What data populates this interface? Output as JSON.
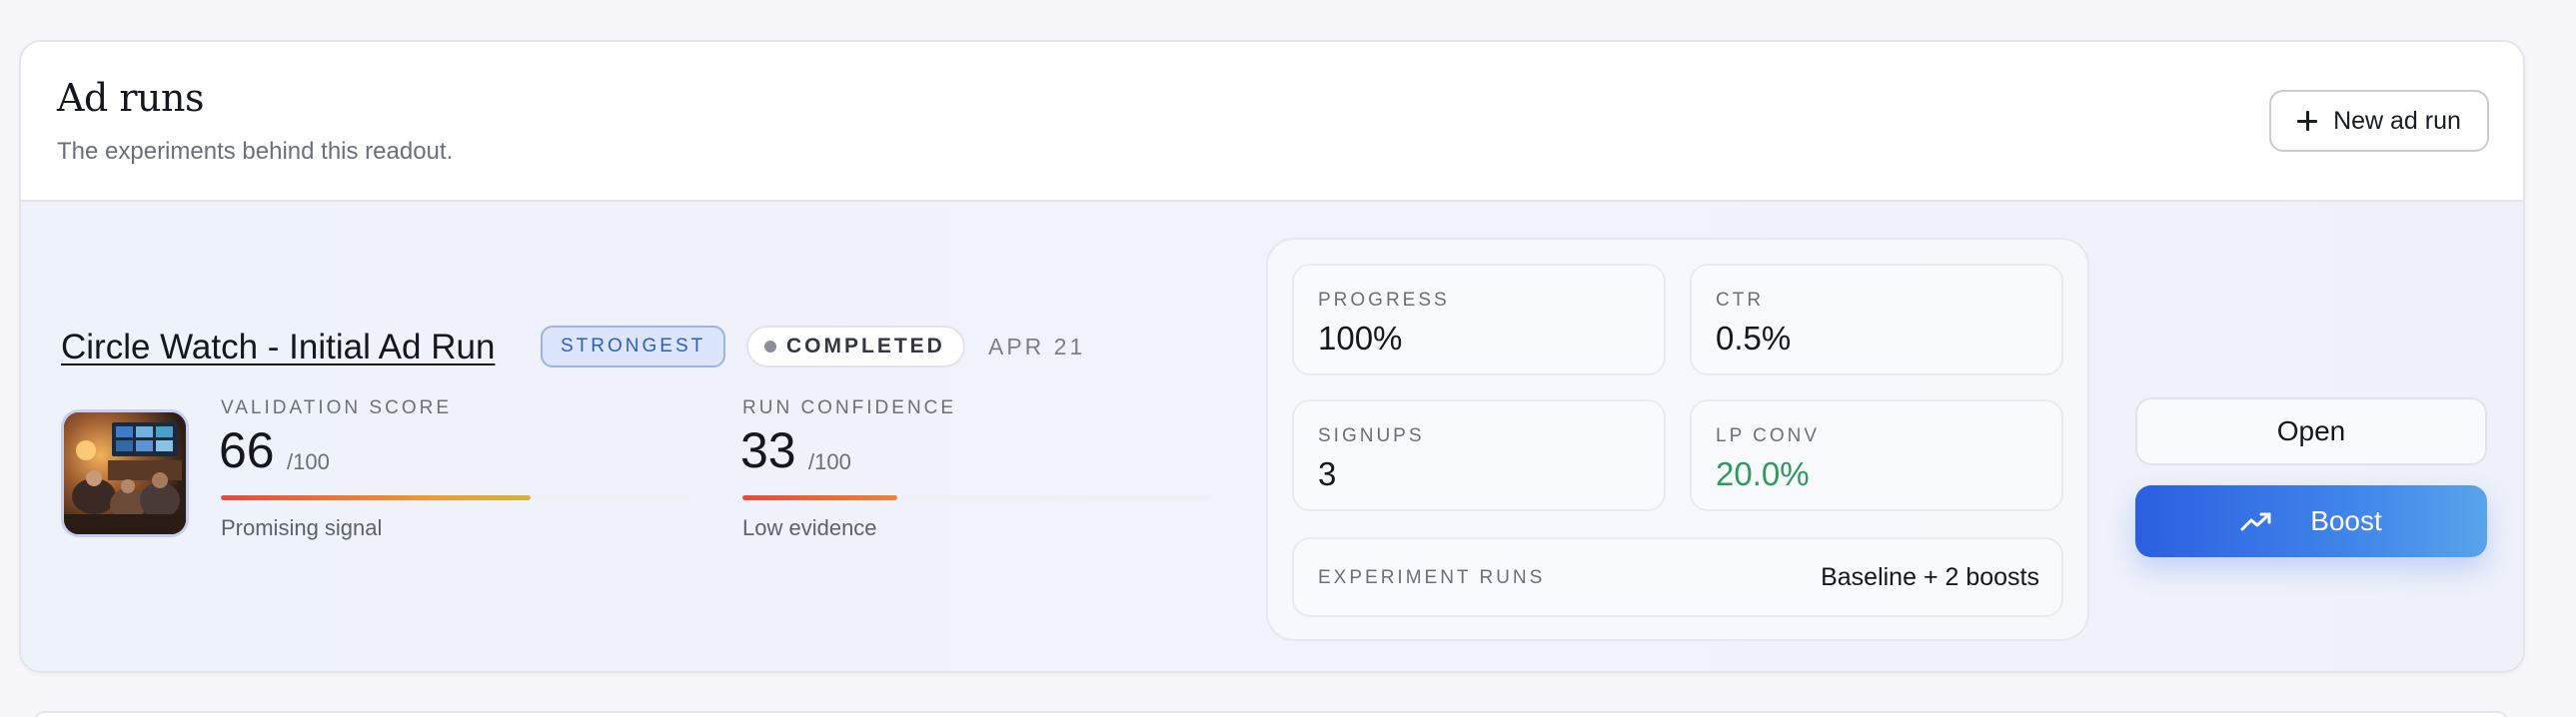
{
  "section": {
    "title": "Ad runs",
    "subtitle": "The experiments behind this readout.",
    "new_button_label": "New ad run"
  },
  "run": {
    "title": "Circle Watch - Initial Ad Run",
    "badge": "STRONGEST",
    "status": "COMPLETED",
    "date": "APR 21",
    "validation": {
      "label": "VALIDATION SCORE",
      "value": "66",
      "unit": "/100",
      "caption": "Promising signal",
      "fraction": 0.66
    },
    "confidence": {
      "label": "RUN CONFIDENCE",
      "value": "33",
      "unit": "/100",
      "caption": "Low evidence",
      "fraction": 0.33
    },
    "stats": {
      "progress": {
        "label": "PROGRESS",
        "value": "100%"
      },
      "ctr": {
        "label": "CTR",
        "value": "0.5%"
      },
      "signups": {
        "label": "SIGNUPS",
        "value": "3"
      },
      "lp_conv": {
        "label": "LP CONV",
        "value": "20.0%"
      },
      "experiment_runs": {
        "label": "EXPERIMENT RUNS",
        "value": "Baseline + 2 boosts"
      }
    },
    "actions": {
      "open_label": "Open",
      "boost_label": "Boost"
    }
  },
  "colors": {
    "accent_blue": "#2b5fe0",
    "positive_green": "#2f9a5a",
    "badge_blue": "#2f5bc4"
  },
  "icons": {
    "new_button": "plus-icon",
    "status": "status-dot-icon",
    "boost": "trending-up-icon",
    "thumbnail": "ad-creative-thumbnail"
  }
}
